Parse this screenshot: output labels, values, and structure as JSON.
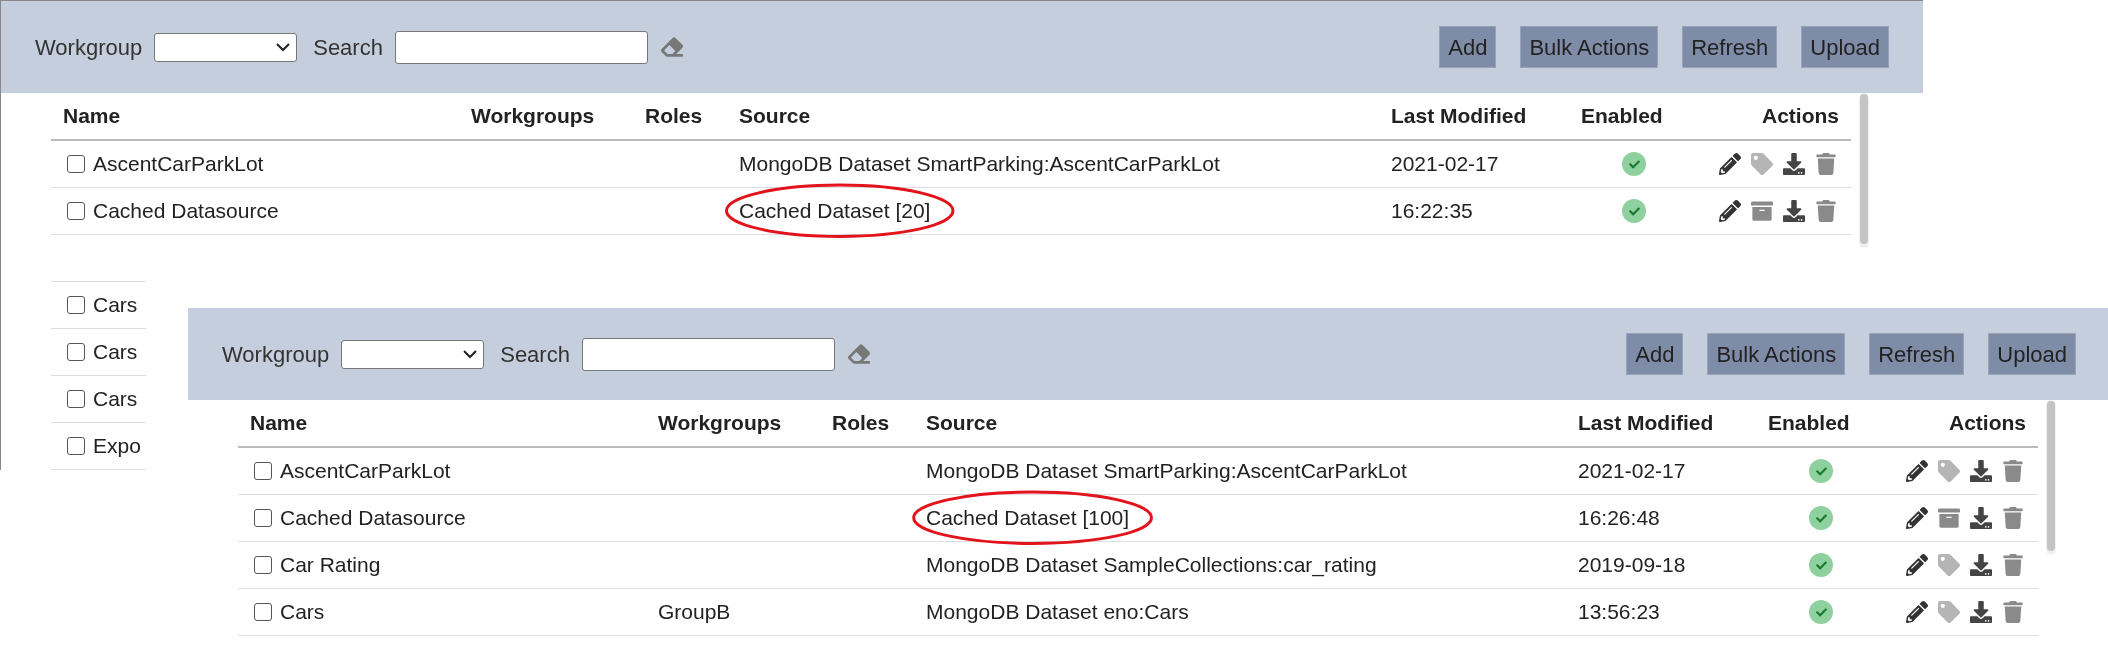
{
  "panels": [
    {
      "filters": {
        "workgroup_label": "Workgroup",
        "search_label": "Search"
      },
      "buttons": [
        "Add",
        "Bulk Actions",
        "Refresh",
        "Upload"
      ],
      "columns": [
        "Name",
        "Workgroups",
        "Roles",
        "Source",
        "Last Modified",
        "Enabled",
        "Actions"
      ],
      "rows": [
        {
          "name": "AscentCarParkLot",
          "checked": false,
          "source": "MongoDB Dataset SmartParking:AscentCarParkLot",
          "circled": false,
          "last_modified": "2021-02-17",
          "enabled": true,
          "actions": [
            {
              "kind": "edit"
            },
            {
              "kind": "tag"
            },
            {
              "kind": "download"
            },
            {
              "kind": "delete"
            }
          ]
        },
        {
          "name": "Cached Datasource",
          "checked": false,
          "source": "Cached Dataset [20]",
          "circled": true,
          "last_modified": "16:22:35",
          "enabled": true,
          "actions": [
            {
              "kind": "edit"
            },
            {
              "kind": "archive"
            },
            {
              "kind": "download"
            },
            {
              "kind": "delete"
            }
          ]
        },
        {},
        {
          "name": "Cars",
          "checked": false
        },
        {
          "name": "Cars",
          "checked": false
        },
        {
          "name": "Cars",
          "checked": false
        },
        {
          "name": "Expo",
          "checked": false
        }
      ]
    },
    {
      "filters": {
        "workgroup_label": "Workgroup",
        "search_label": "Search"
      },
      "buttons": [
        "Add",
        "Bulk Actions",
        "Refresh",
        "Upload"
      ],
      "columns": [
        "Name",
        "Workgroups",
        "Roles",
        "Source",
        "Last Modified",
        "Enabled",
        "Actions"
      ],
      "rows": [
        {
          "name": "AscentCarParkLot",
          "checked": false,
          "source": "MongoDB Dataset SmartParking:AscentCarParkLot",
          "circled": false,
          "last_modified": "2021-02-17",
          "enabled": true,
          "actions": [
            {
              "kind": "edit"
            },
            {
              "kind": "tag"
            },
            {
              "kind": "download"
            },
            {
              "kind": "delete"
            }
          ]
        },
        {
          "name": "Cached Datasource",
          "checked": false,
          "source": "Cached Dataset [100]",
          "circled": true,
          "last_modified": "16:26:48",
          "enabled": true,
          "actions": [
            {
              "kind": "edit"
            },
            {
              "kind": "archive"
            },
            {
              "kind": "download"
            },
            {
              "kind": "delete"
            }
          ]
        },
        {
          "name": "Car Rating",
          "checked": false,
          "source": "MongoDB Dataset SampleCollections:car_rating",
          "circled": false,
          "last_modified": "2019-09-18",
          "enabled": true,
          "actions": [
            {
              "kind": "edit"
            },
            {
              "kind": "tag"
            },
            {
              "kind": "download"
            },
            {
              "kind": "delete"
            }
          ]
        },
        {
          "name": "Cars",
          "checked": false,
          "workgroups": "GroupB",
          "source": "MongoDB Dataset eno:Cars",
          "circled": false,
          "last_modified": "13:56:23",
          "enabled": true,
          "actions": [
            {
              "kind": "edit"
            },
            {
              "kind": "tag"
            },
            {
              "kind": "download"
            },
            {
              "kind": "delete"
            }
          ]
        }
      ]
    }
  ]
}
